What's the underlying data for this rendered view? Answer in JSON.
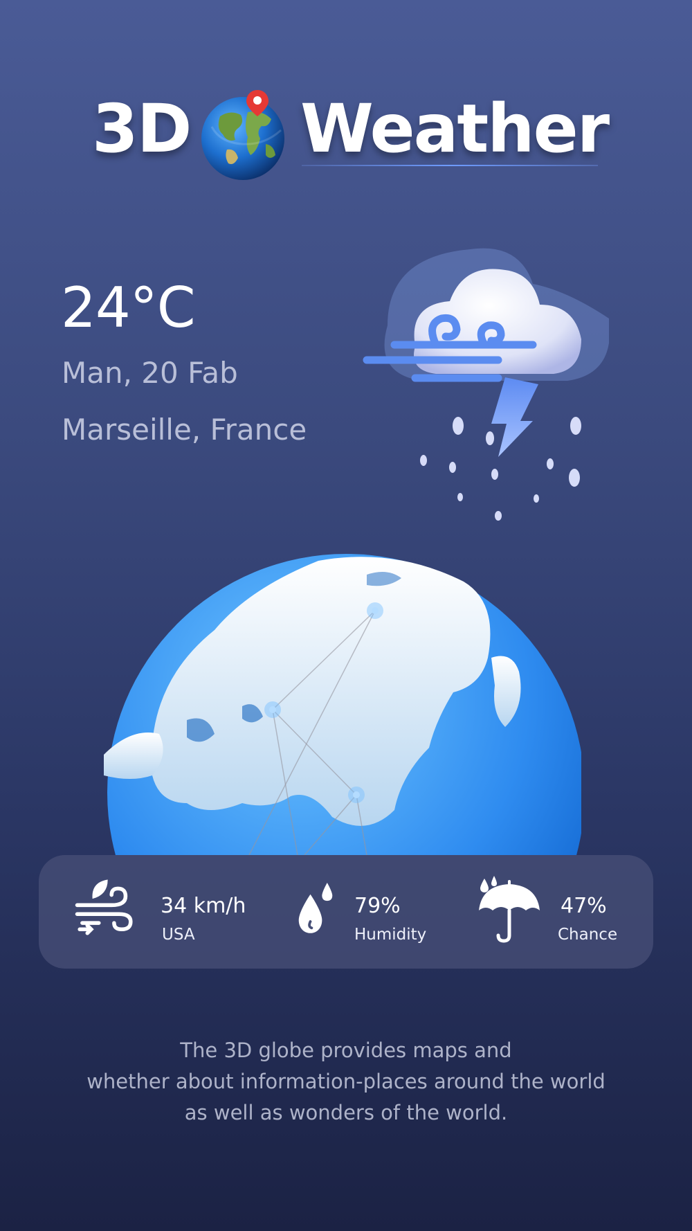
{
  "header": {
    "title_left": "3D",
    "title_right": "Weather",
    "globe_icon": "earth-globe-pin-icon"
  },
  "current": {
    "temperature": "24°C",
    "date": "Man, 20 Fab",
    "location": "Marseille, France",
    "condition_icon": "storm-cloud-wind-rain-icon"
  },
  "globe_icon": "earth-globe-routes-icon",
  "stats": {
    "wind": {
      "value": "34 km/h",
      "label": "USA",
      "icon": "wind-leaf-icon"
    },
    "humidity": {
      "value": "79%",
      "label": "Humidity",
      "icon": "water-drops-icon"
    },
    "rain": {
      "value": "47%",
      "label": "Chance",
      "icon": "umbrella-rain-icon"
    }
  },
  "description": {
    "line1": "The 3D globe provides maps and",
    "line2": "whether about information-places around the world",
    "line3": "as well as wonders of the world."
  },
  "colors": {
    "bg_top": "#4a5b96",
    "bg_bottom": "#1b2244",
    "accent_blue": "#2f8cf0",
    "card": "#464e76"
  }
}
